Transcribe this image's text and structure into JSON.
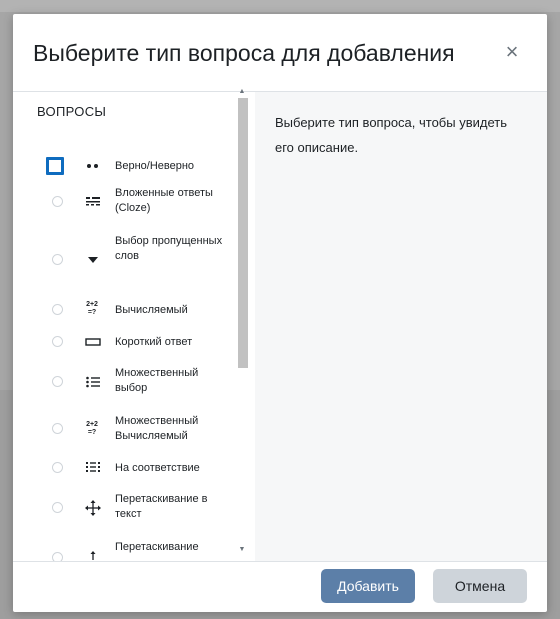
{
  "dialog": {
    "title": "Выберите тип вопроса для добавления",
    "close_symbol": "×"
  },
  "options_panel": {
    "section_title": "ВОПРОСЫ",
    "items": [
      {
        "label": "Верно/Неверно",
        "icon": "true-false-icon",
        "selected": true
      },
      {
        "label": "Вложенные ответы (Cloze)",
        "icon": "cloze-icon",
        "selected": false
      },
      {
        "label": "Выбор пропущенных слов",
        "icon": "dropdown-arrow-icon",
        "selected": false
      },
      {
        "label": "Вычисляемый",
        "icon": "calculated-icon",
        "icon_text": "2+2 =?",
        "selected": false
      },
      {
        "label": "Короткий ответ",
        "icon": "short-answer-icon",
        "selected": false
      },
      {
        "label": "Множественный выбор",
        "icon": "multichoice-icon",
        "selected": false
      },
      {
        "label": "Множественный Вычисляемый",
        "icon": "calculated-multi-icon",
        "icon_text": "2+2 =?",
        "selected": false
      },
      {
        "label": "На соответствие",
        "icon": "matching-icon",
        "selected": false
      },
      {
        "label": "Перетаскивание в текст",
        "icon": "drag-move-icon",
        "selected": false
      },
      {
        "label": "Перетаскивание",
        "icon": "drag-icon",
        "selected": false
      }
    ]
  },
  "description_panel": {
    "text": "Выберите тип вопроса, чтобы увидеть его описание."
  },
  "footer": {
    "add_label": "Добавить",
    "cancel_label": "Отмена"
  },
  "colors": {
    "primary_button": "#5c7fa8",
    "secondary_button": "#ced4da",
    "selected_radio": "#0f6cbf",
    "overlay": "#a6a6a6"
  }
}
